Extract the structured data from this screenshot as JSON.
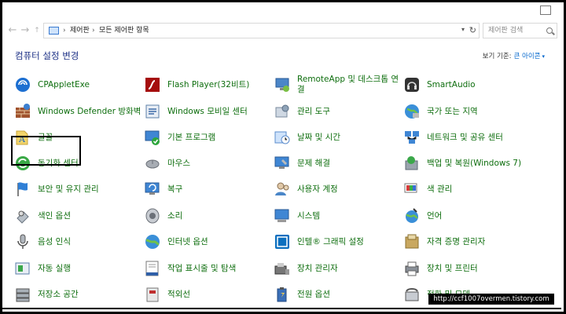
{
  "window": {
    "nav": {
      "back_icon": "back-arrow-icon",
      "forward_icon": "forward-arrow-icon",
      "up_icon": "up-arrow-icon"
    },
    "address": {
      "crumb1": "제어판",
      "crumb2": "모든 제어판 항목"
    },
    "search": {
      "placeholder": "제어판 검색"
    }
  },
  "header": {
    "title": "컴퓨터 설정 변경",
    "view_by_label": "보기 기준:",
    "view_by_value": "큰 아이콘"
  },
  "colors": {
    "item_text": "#0e6e0e",
    "title_text": "#1e3287",
    "link": "#0066cc"
  },
  "items": [
    {
      "label": "CPAppletExe",
      "icon": "cpapplet-icon"
    },
    {
      "label": "Flash Player(32비트)",
      "icon": "flash-player-icon"
    },
    {
      "label": "RemoteApp 및 데스크톱 연결",
      "icon": "remoteapp-icon"
    },
    {
      "label": "SmartAudio",
      "icon": "smartaudio-icon"
    },
    {
      "label": "Windows Defender 방화벽",
      "icon": "firewall-icon"
    },
    {
      "label": "Windows 모비일 센터",
      "icon": "mobility-center-icon"
    },
    {
      "label": "관리 도구",
      "icon": "admin-tools-icon"
    },
    {
      "label": "국가 또는 지역",
      "icon": "region-icon"
    },
    {
      "label": "글꼴",
      "icon": "fonts-icon"
    },
    {
      "label": "기본 프로그램",
      "icon": "default-programs-icon"
    },
    {
      "label": "날짜 및 시간",
      "icon": "date-time-icon"
    },
    {
      "label": "네트워크 및 공유 센터",
      "icon": "network-icon"
    },
    {
      "label": "동기화 센터",
      "icon": "sync-center-icon"
    },
    {
      "label": "마우스",
      "icon": "mouse-icon"
    },
    {
      "label": "문제 해결",
      "icon": "troubleshooting-icon"
    },
    {
      "label": "백업 및 복원(Windows 7)",
      "icon": "backup-icon"
    },
    {
      "label": "보안 및 유지 관리",
      "icon": "security-flag-icon"
    },
    {
      "label": "복구",
      "icon": "recovery-icon"
    },
    {
      "label": "사용자 계정",
      "icon": "user-accounts-icon"
    },
    {
      "label": "색 관리",
      "icon": "color-management-icon"
    },
    {
      "label": "색인 옵션",
      "icon": "indexing-icon"
    },
    {
      "label": "소리",
      "icon": "sound-icon"
    },
    {
      "label": "시스템",
      "icon": "system-icon"
    },
    {
      "label": "언어",
      "icon": "language-icon"
    },
    {
      "label": "음성 인식",
      "icon": "microphone-icon"
    },
    {
      "label": "인터넷 옵션",
      "icon": "internet-options-icon"
    },
    {
      "label": "인텔® 그래픽 설정",
      "icon": "intel-graphics-icon"
    },
    {
      "label": "자격 증명 관리자",
      "icon": "credential-icon"
    },
    {
      "label": "자동 실행",
      "icon": "autoplay-icon"
    },
    {
      "label": "작업 표시줄 및 탐색",
      "icon": "taskbar-icon"
    },
    {
      "label": "장치 관리자",
      "icon": "device-manager-icon"
    },
    {
      "label": "장치 및 프린터",
      "icon": "printer-icon"
    },
    {
      "label": "저장소 공간",
      "icon": "storage-icon"
    },
    {
      "label": "적외선",
      "icon": "infrared-icon"
    },
    {
      "label": "전원 옵션",
      "icon": "power-icon"
    },
    {
      "label": "전화 및 모뎀",
      "icon": "phone-modem-icon"
    }
  ],
  "watermark": "http://ccf1007overmen.tistory.com"
}
